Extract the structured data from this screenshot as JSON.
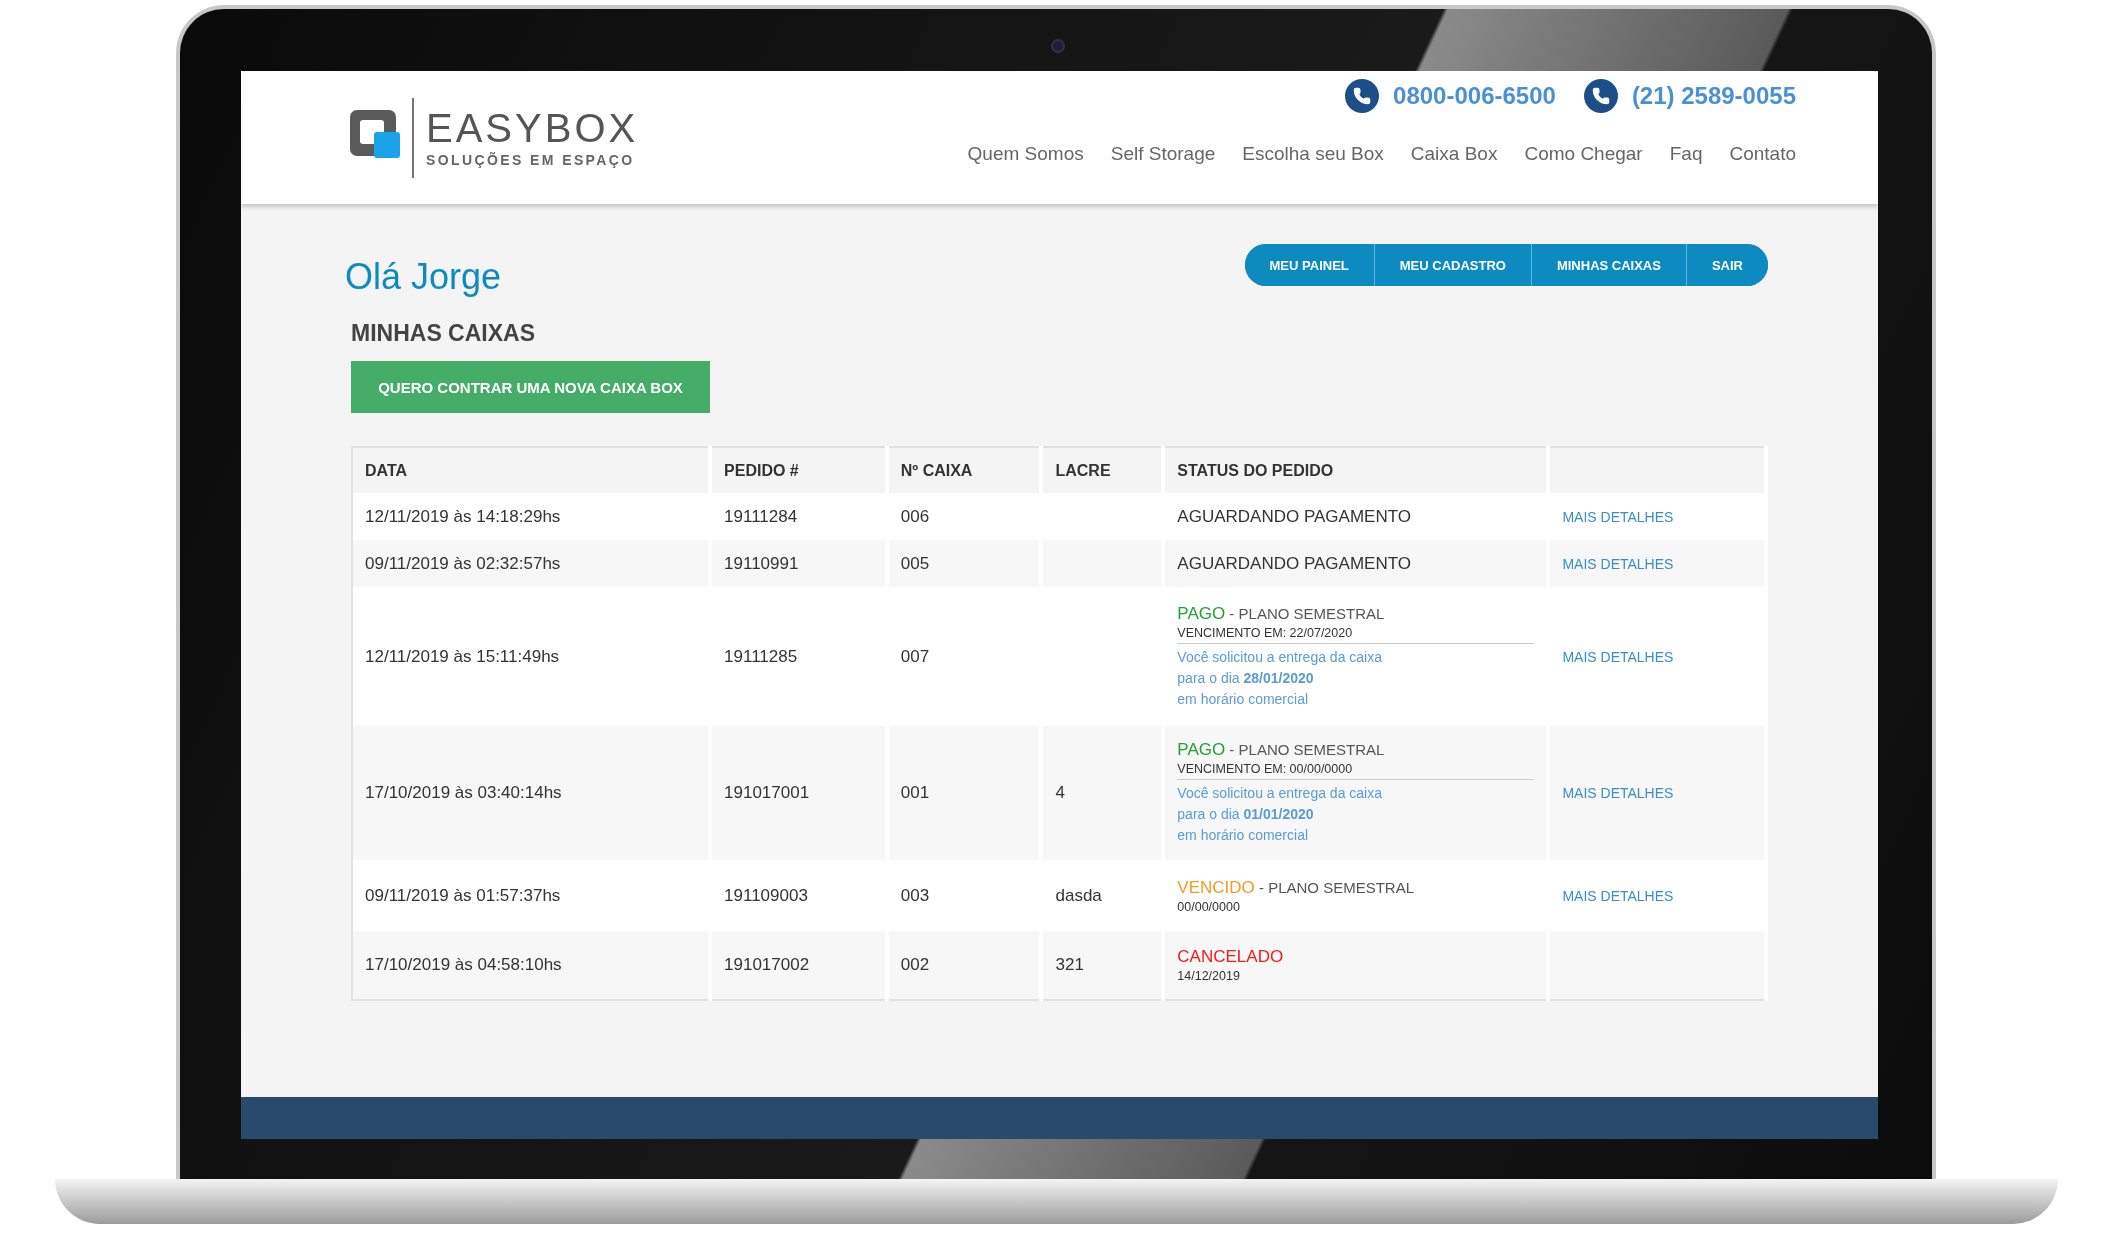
{
  "header": {
    "logo": {
      "name": "EASYBOX",
      "tagline": "SOLUÇÕES EM ESPAÇO"
    },
    "phones": [
      "0800-006-6500",
      "(21) 2589-0055"
    ],
    "nav": [
      "Quem Somos",
      "Self Storage",
      "Escolha seu Box",
      "Caixa Box",
      "Como Chegar",
      "Faq",
      "Contato"
    ]
  },
  "greeting": "Olá Jorge",
  "account_menu": [
    "MEU PAINEL",
    "MEU CADASTRO",
    "MINHAS CAIXAS",
    "SAIR"
  ],
  "section_title": "MINHAS CAIXAS",
  "new_box_button": "QUERO CONTRAR UMA NOVA CAIXA BOX",
  "table": {
    "columns": [
      "DATA",
      "PEDIDO #",
      "Nº CAIXA",
      "LACRE",
      "STATUS DO PEDIDO"
    ],
    "rows": [
      {
        "data": "12/11/2019 às 14:18:29hs",
        "pedido": "19111284",
        "caixa": "006",
        "status": {
          "kind": "plain",
          "label": "AGUARDANDO PAGAMENTO"
        },
        "action": "MAIS DETALHES"
      },
      {
        "data": "09/11/2019 às 02:32:57hs",
        "pedido": "19110991",
        "caixa": "005",
        "status": {
          "kind": "plain",
          "label": "AGUARDANDO PAGAMENTO"
        },
        "action": "MAIS DETALHES"
      },
      {
        "data": "12/11/2019 às 15:11:49hs",
        "pedido": "19111285",
        "caixa": "007",
        "status": {
          "kind": "detailed",
          "label": "PAGO",
          "color": "#22a036",
          "plan": " - PLANO SEMESTRAL",
          "date": "VENCIMENTO EM: 22/07/2020",
          "delivery": [
            "Você solicitou a entrega da caixa",
            "para o dia **28/01/2020**",
            "em horário comercial"
          ]
        },
        "action": "MAIS DETALHES"
      },
      {
        "data": "17/10/2019 às 03:40:14hs",
        "pedido": "191017001",
        "caixa": "001",
        "lacre": "4",
        "status": {
          "kind": "detailed",
          "label": "PAGO",
          "color": "#22a036",
          "plan": " - PLANO SEMESTRAL",
          "date": "VENCIMENTO EM: 00/00/0000",
          "delivery": [
            "Você solicitou a entrega da caixa",
            "para o dia **01/01/2020**",
            "em horário comercial"
          ]
        },
        "action": "MAIS DETALHES"
      },
      {
        "data": "09/11/2019 às 01:57:37hs",
        "pedido": "191109003",
        "caixa": "003",
        "lacre": "dasda",
        "status": {
          "kind": "detailed",
          "label": "VENCIDO",
          "color": "#f79a1e",
          "plan": " - PLANO SEMESTRAL",
          "date": "00/00/0000"
        },
        "action": "MAIS DETALHES"
      },
      {
        "data": "17/10/2019 às 04:58:10hs",
        "pedido": "191017002",
        "caixa": "002",
        "lacre": "321",
        "status": {
          "kind": "detailed",
          "label": "CANCELADO",
          "color": "#ee1c1c",
          "date": "14/12/2019"
        }
      }
    ]
  }
}
